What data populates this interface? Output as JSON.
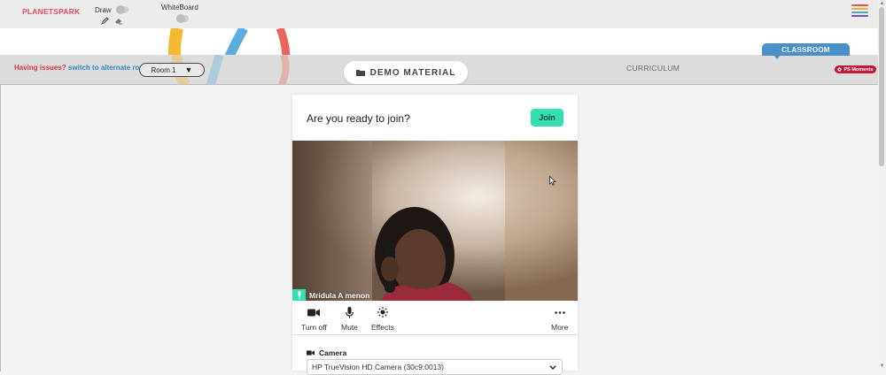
{
  "topbar": {
    "logo_text": "PLANETSPARK",
    "draw_label": "Draw",
    "whiteboard_label": "WhiteBoard",
    "menu_colors": [
      "#e8514a",
      "#f3b11b",
      "#4aa3df",
      "#7c4fbf"
    ]
  },
  "band": {
    "issues_question": "Having issues?",
    "issues_link": "switch to alternate room",
    "room_selected": "Room 1",
    "demo_material": "DEMO MATERIAL",
    "curriculum": "CURRICULUM",
    "classroom": "CLASSROOM",
    "ps_moments": "PS Moments"
  },
  "prejoin": {
    "title": "Are you ready to join?",
    "join_label": "Join",
    "participant_name": "Mridula A menon",
    "controls": [
      {
        "label": "Turn off",
        "icon": "video-camera-icon"
      },
      {
        "label": "Mute",
        "icon": "microphone-icon"
      },
      {
        "label": "Effects",
        "icon": "effects-sun-icon"
      },
      {
        "label": "More",
        "icon": "more-dots-icon"
      }
    ],
    "camera_label": "Camera",
    "camera_value": "HP TrueVision HD Camera (30c9:0013)"
  },
  "colors": {
    "accent_teal": "#34e0b0",
    "brand_red": "#d9304f",
    "link_blue": "#2b8bd1",
    "classroom_blue": "#4a90c8",
    "ps_moments_red": "#c4183c"
  }
}
